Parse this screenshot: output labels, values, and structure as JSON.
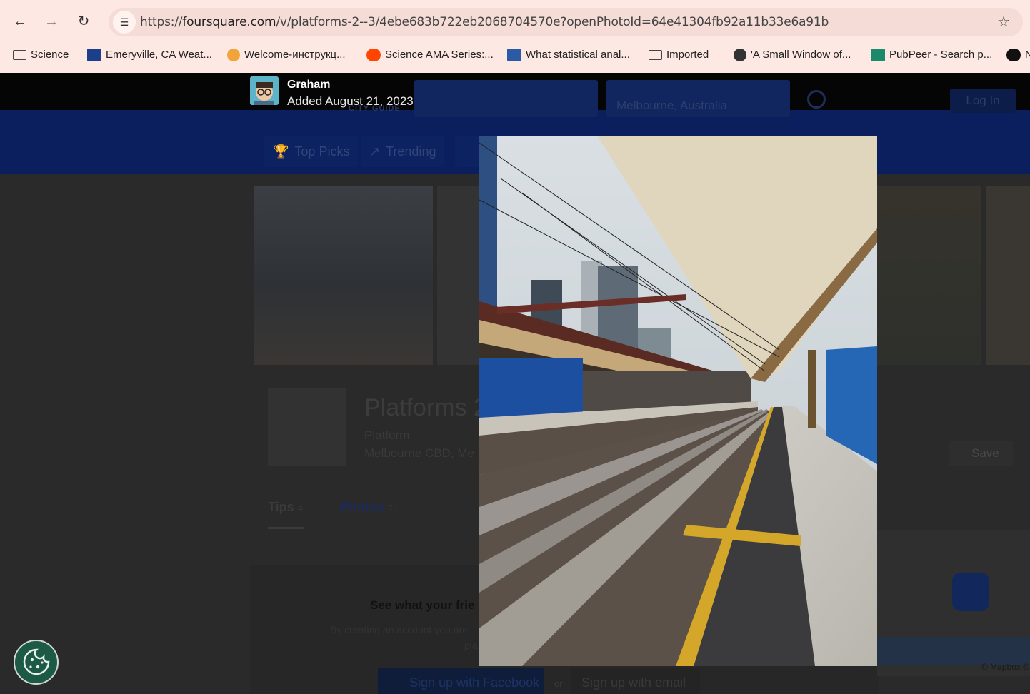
{
  "browser": {
    "url_prefix": "https://",
    "url_host": "foursquare.com",
    "url_path": "/v/platforms-2--3/4ebe683b722eb2068704570e?openPhotoId=64e41304fb92a11b33e6a91b",
    "bookmarks": [
      {
        "label": "Science",
        "icon": "folder-icon"
      },
      {
        "label": "Emeryville, CA Weat...",
        "icon": "weather-channel-icon"
      },
      {
        "label": "Welcome-инструкц...",
        "icon": "handshake-icon"
      },
      {
        "label": "Science AMA Series:...",
        "icon": "reddit-icon"
      },
      {
        "label": "What statistical anal...",
        "icon": "ucla-icon"
      },
      {
        "label": "Imported",
        "icon": "folder-icon"
      },
      {
        "label": "'A Small Window of...",
        "icon": "site-icon"
      },
      {
        "label": "PubPeer - Search p...",
        "icon": "pubpeer-icon"
      },
      {
        "label": "N",
        "icon": "s6-icon"
      }
    ]
  },
  "site": {
    "city_guide": "CITY GUIDE",
    "location_search": "Melbourne, Australia",
    "login_label": "Log In",
    "nav_tabs": [
      "Top Picks",
      "Trending"
    ],
    "venue": {
      "title": "Platforms 2",
      "category": "Platform",
      "address": "Melbourne CBD, Me"
    },
    "save_label": "Save",
    "tabs": {
      "tips_label": "Tips",
      "tips_count": "4",
      "photos_label": "Photos",
      "photos_count": "71"
    },
    "signup": {
      "headline": "See what your frie",
      "body_line1": "By creating an account you are",
      "body_line2": "pla",
      "facebook_label": "Sign up with Facebook",
      "or_label": "or",
      "email_label": "Sign up with email"
    },
    "map_attribution": "© Mapbox ©"
  },
  "photo_overlay": {
    "user_name": "Graham",
    "added_date": "Added August 21, 2023"
  },
  "colors": {
    "browser_chrome": "#fde8e3",
    "site_header": "#0b1f5e",
    "cookie_button": "#1d5a46"
  }
}
